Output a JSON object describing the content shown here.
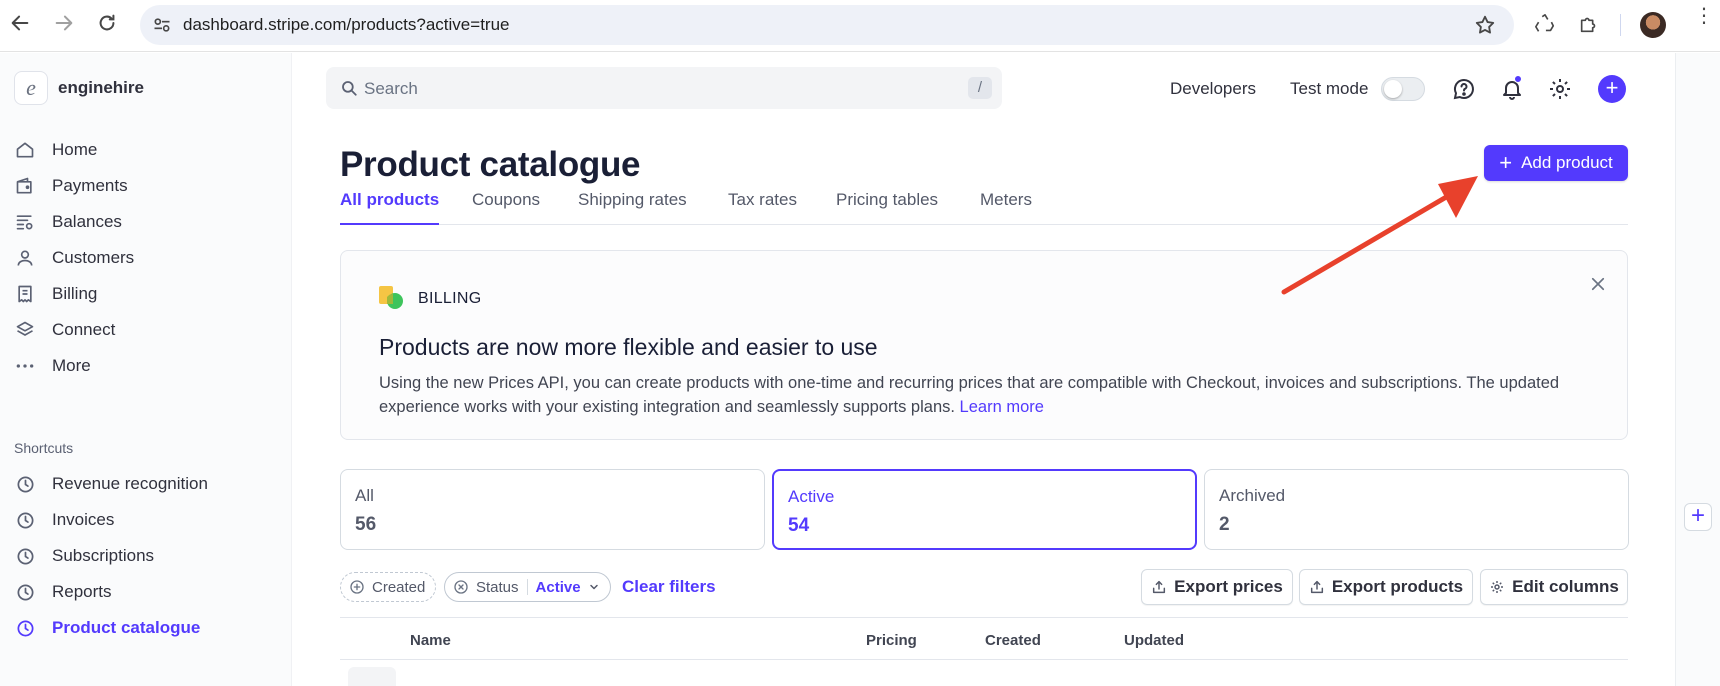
{
  "browser": {
    "url": "dashboard.stripe.com/products?active=true"
  },
  "account": {
    "name": "enginehire",
    "logo_letter": "e"
  },
  "header": {
    "search_placeholder": "Search",
    "search_shortcut": "/",
    "developers": "Developers",
    "test_mode": "Test mode"
  },
  "sidebar": {
    "items": [
      {
        "label": "Home",
        "icon": "home-icon"
      },
      {
        "label": "Payments",
        "icon": "wallet-icon"
      },
      {
        "label": "Balances",
        "icon": "balances-icon"
      },
      {
        "label": "Customers",
        "icon": "person-icon"
      },
      {
        "label": "Billing",
        "icon": "receipt-icon"
      },
      {
        "label": "Connect",
        "icon": "layers-icon"
      },
      {
        "label": "More",
        "icon": "more-icon"
      }
    ],
    "shortcuts_label": "Shortcuts",
    "shortcuts": [
      {
        "label": "Revenue recognition",
        "icon": "clock-icon"
      },
      {
        "label": "Invoices",
        "icon": "clock-icon"
      },
      {
        "label": "Subscriptions",
        "icon": "clock-icon"
      },
      {
        "label": "Reports",
        "icon": "clock-icon"
      },
      {
        "label": "Product catalogue",
        "icon": "clock-icon",
        "active": true
      }
    ]
  },
  "page": {
    "title": "Product catalogue",
    "add_button": "Add product",
    "tabs": [
      "All products",
      "Coupons",
      "Shipping rates",
      "Tax rates",
      "Pricing tables",
      "Meters"
    ],
    "active_tab": "All products"
  },
  "banner": {
    "label": "BILLING",
    "title": "Products are now more flexible and easier to use",
    "body": "Using the new Prices API, you can create products with one-time and recurring prices that are compatible with Checkout, invoices and subscriptions. The updated experience works with your existing integration and seamlessly supports plans.",
    "link": "Learn more"
  },
  "stats": [
    {
      "label": "All",
      "value": "56"
    },
    {
      "label": "Active",
      "value": "54",
      "active": true
    },
    {
      "label": "Archived",
      "value": "2"
    }
  ],
  "filters": {
    "created": "Created",
    "status": "Status",
    "status_value": "Active",
    "clear": "Clear filters"
  },
  "table_actions": {
    "export_prices": "Export prices",
    "export_products": "Export products",
    "edit_columns": "Edit columns"
  },
  "table": {
    "columns": [
      "Name",
      "Pricing",
      "Created",
      "Updated"
    ]
  },
  "colors": {
    "accent": "#533afd",
    "annotation_arrow": "#e8412c"
  }
}
